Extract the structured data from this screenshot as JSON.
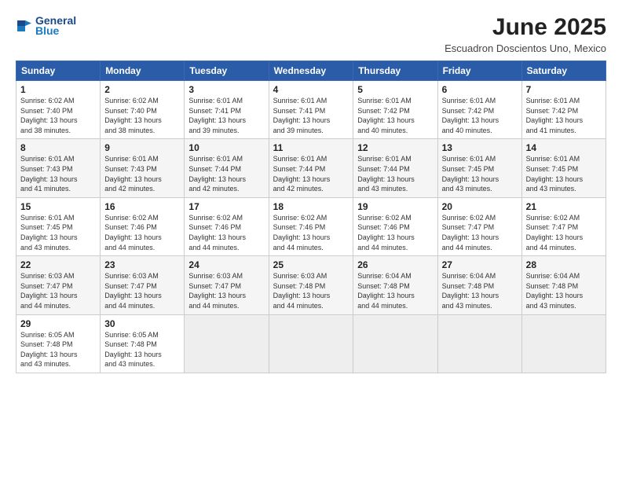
{
  "header": {
    "logo_line1": "General",
    "logo_line2": "Blue",
    "month": "June 2025",
    "location": "Escuadron Doscientos Uno, Mexico"
  },
  "days_of_week": [
    "Sunday",
    "Monday",
    "Tuesday",
    "Wednesday",
    "Thursday",
    "Friday",
    "Saturday"
  ],
  "weeks": [
    [
      {
        "day": "1",
        "rise": "6:02 AM",
        "set": "7:40 PM",
        "daylight": "13 hours and 38 minutes."
      },
      {
        "day": "2",
        "rise": "6:02 AM",
        "set": "7:40 PM",
        "daylight": "13 hours and 38 minutes."
      },
      {
        "day": "3",
        "rise": "6:01 AM",
        "set": "7:41 PM",
        "daylight": "13 hours and 39 minutes."
      },
      {
        "day": "4",
        "rise": "6:01 AM",
        "set": "7:41 PM",
        "daylight": "13 hours and 39 minutes."
      },
      {
        "day": "5",
        "rise": "6:01 AM",
        "set": "7:42 PM",
        "daylight": "13 hours and 40 minutes."
      },
      {
        "day": "6",
        "rise": "6:01 AM",
        "set": "7:42 PM",
        "daylight": "13 hours and 40 minutes."
      },
      {
        "day": "7",
        "rise": "6:01 AM",
        "set": "7:42 PM",
        "daylight": "13 hours and 41 minutes."
      }
    ],
    [
      {
        "day": "8",
        "rise": "6:01 AM",
        "set": "7:43 PM",
        "daylight": "13 hours and 41 minutes."
      },
      {
        "day": "9",
        "rise": "6:01 AM",
        "set": "7:43 PM",
        "daylight": "13 hours and 42 minutes."
      },
      {
        "day": "10",
        "rise": "6:01 AM",
        "set": "7:44 PM",
        "daylight": "13 hours and 42 minutes."
      },
      {
        "day": "11",
        "rise": "6:01 AM",
        "set": "7:44 PM",
        "daylight": "13 hours and 42 minutes."
      },
      {
        "day": "12",
        "rise": "6:01 AM",
        "set": "7:44 PM",
        "daylight": "13 hours and 43 minutes."
      },
      {
        "day": "13",
        "rise": "6:01 AM",
        "set": "7:45 PM",
        "daylight": "13 hours and 43 minutes."
      },
      {
        "day": "14",
        "rise": "6:01 AM",
        "set": "7:45 PM",
        "daylight": "13 hours and 43 minutes."
      }
    ],
    [
      {
        "day": "15",
        "rise": "6:01 AM",
        "set": "7:45 PM",
        "daylight": "13 hours and 43 minutes."
      },
      {
        "day": "16",
        "rise": "6:02 AM",
        "set": "7:46 PM",
        "daylight": "13 hours and 44 minutes."
      },
      {
        "day": "17",
        "rise": "6:02 AM",
        "set": "7:46 PM",
        "daylight": "13 hours and 44 minutes."
      },
      {
        "day": "18",
        "rise": "6:02 AM",
        "set": "7:46 PM",
        "daylight": "13 hours and 44 minutes."
      },
      {
        "day": "19",
        "rise": "6:02 AM",
        "set": "7:46 PM",
        "daylight": "13 hours and 44 minutes."
      },
      {
        "day": "20",
        "rise": "6:02 AM",
        "set": "7:47 PM",
        "daylight": "13 hours and 44 minutes."
      },
      {
        "day": "21",
        "rise": "6:02 AM",
        "set": "7:47 PM",
        "daylight": "13 hours and 44 minutes."
      }
    ],
    [
      {
        "day": "22",
        "rise": "6:03 AM",
        "set": "7:47 PM",
        "daylight": "13 hours and 44 minutes."
      },
      {
        "day": "23",
        "rise": "6:03 AM",
        "set": "7:47 PM",
        "daylight": "13 hours and 44 minutes."
      },
      {
        "day": "24",
        "rise": "6:03 AM",
        "set": "7:47 PM",
        "daylight": "13 hours and 44 minutes."
      },
      {
        "day": "25",
        "rise": "6:03 AM",
        "set": "7:48 PM",
        "daylight": "13 hours and 44 minutes."
      },
      {
        "day": "26",
        "rise": "6:04 AM",
        "set": "7:48 PM",
        "daylight": "13 hours and 44 minutes."
      },
      {
        "day": "27",
        "rise": "6:04 AM",
        "set": "7:48 PM",
        "daylight": "13 hours and 43 minutes."
      },
      {
        "day": "28",
        "rise": "6:04 AM",
        "set": "7:48 PM",
        "daylight": "13 hours and 43 minutes."
      }
    ],
    [
      {
        "day": "29",
        "rise": "6:05 AM",
        "set": "7:48 PM",
        "daylight": "13 hours and 43 minutes."
      },
      {
        "day": "30",
        "rise": "6:05 AM",
        "set": "7:48 PM",
        "daylight": "13 hours and 43 minutes."
      },
      null,
      null,
      null,
      null,
      null
    ]
  ],
  "labels": {
    "sunrise": "Sunrise:",
    "sunset": "Sunset:",
    "daylight": "Daylight:"
  }
}
